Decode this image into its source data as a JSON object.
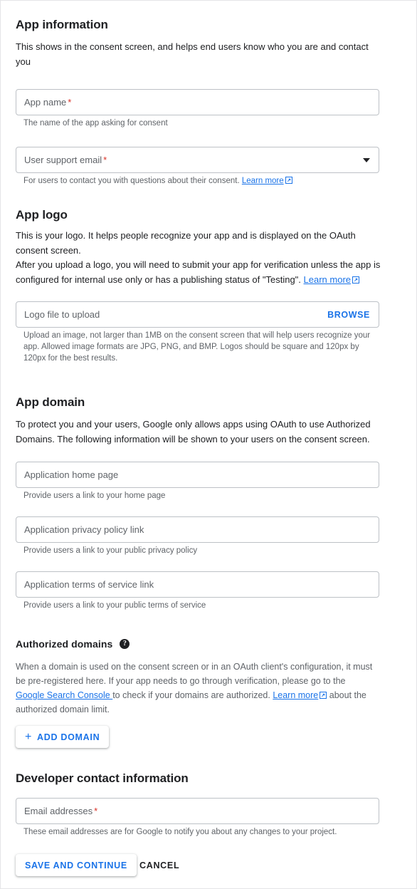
{
  "colors": {
    "accent": "#1a73e8",
    "required": "#d93025",
    "text": "#202124",
    "muted": "#5f6368",
    "border": "#bdc1c6"
  },
  "app_information": {
    "title": "App information",
    "description": "This shows in the consent screen, and helps end users know who you are and contact you",
    "app_name_field": {
      "label": "App name",
      "required_marker": "*",
      "value": "",
      "hint": "The name of the app asking for consent"
    },
    "user_support_email_field": {
      "label": "User support email",
      "required_marker": "*",
      "value": "",
      "hint_prefix": "For users to contact you with questions about their consent. ",
      "hint_link": "Learn more",
      "caret_icon": "chevron-down-icon"
    }
  },
  "app_logo": {
    "title": "App logo",
    "description_line1": "This is your logo. It helps people recognize your app and is displayed on the OAuth consent screen.",
    "description_line2_prefix": "After you upload a logo, you will need to submit your app for verification unless the app is configured for internal use only or has a publishing status of \"Testing\". ",
    "description_link": "Learn more",
    "upload_field": {
      "label": "Logo file to upload",
      "value": "",
      "browse_label": "BROWSE"
    },
    "hint": "Upload an image, not larger than 1MB on the consent screen that will help users recognize your app. Allowed image formats are JPG, PNG, and BMP. Logos should be square and 120px by 120px for the best results."
  },
  "app_domain": {
    "title": "App domain",
    "description": "To protect you and your users, Google only allows apps using OAuth to use Authorized Domains. The following information will be shown to your users on the consent screen.",
    "fields": [
      {
        "label": "Application home page",
        "value": "",
        "hint": "Provide users a link to your home page"
      },
      {
        "label": "Application privacy policy link",
        "value": "",
        "hint": "Provide users a link to your public privacy policy"
      },
      {
        "label": "Application terms of service link",
        "value": "",
        "hint": "Provide users a link to your public terms of service"
      }
    ]
  },
  "authorized_domains": {
    "title": "Authorized domains",
    "help_icon": "help-circle-icon",
    "desc_part1": "When a domain is used on the consent screen or in an OAuth client's configuration, it must be pre-registered here. If your app needs to go through verification, please go to the ",
    "desc_link1": "Google Search Console ",
    "desc_part2": "to check if your domains are authorized. ",
    "desc_link2": "Learn more",
    "desc_part3": " about the authorized domain limit.",
    "add_domain_button": {
      "label": "ADD DOMAIN",
      "plus_icon": "plus-icon"
    }
  },
  "developer_contact": {
    "title": "Developer contact information",
    "email_field": {
      "label": "Email addresses",
      "required_marker": "*",
      "value": "",
      "hint": "These email addresses are for Google to notify you about any changes to your project."
    }
  },
  "actions": {
    "save_label": "SAVE AND CONTINUE",
    "cancel_label": "CANCEL"
  }
}
